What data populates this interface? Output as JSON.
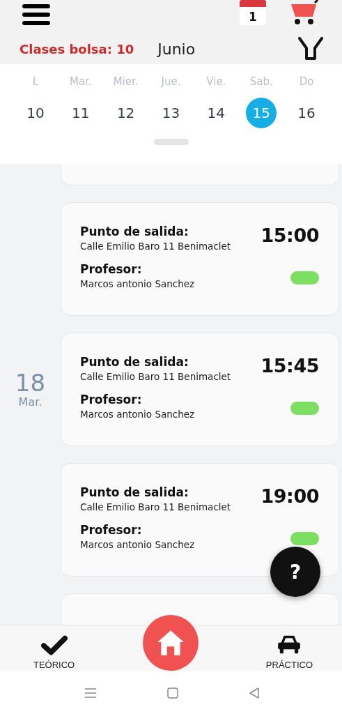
{
  "header": {
    "calendar_badge": "1",
    "credits": "Clases bolsa: 10",
    "month": "Junio"
  },
  "week": [
    {
      "weekday": "L",
      "day": "10",
      "selected": false
    },
    {
      "weekday": "Mar.",
      "day": "11",
      "selected": false
    },
    {
      "weekday": "Mier.",
      "day": "12",
      "selected": false
    },
    {
      "weekday": "Jue.",
      "day": "13",
      "selected": false
    },
    {
      "weekday": "Vie.",
      "day": "14",
      "selected": false
    },
    {
      "weekday": "Sab.",
      "day": "15",
      "selected": true
    },
    {
      "weekday": "Do",
      "day": "16",
      "selected": false
    }
  ],
  "classes": [
    {
      "start_label": "Punto de salida:",
      "address": "Calle Emilio Baro 11 Benimaclet",
      "teacher_label": "Profesor:",
      "teacher": "Marcos antonio Sanchez",
      "time": "15:00",
      "color": "#7ddf62"
    },
    {
      "date_day": "18",
      "date_weekday": "Mar.",
      "start_label": "Punto de salida:",
      "address": "Calle Emilio Baro 11 Benimaclet",
      "teacher_label": "Profesor:",
      "teacher": "Marcos antonio Sanchez",
      "time": "15:45",
      "color": "#7ddf62"
    },
    {
      "start_label": "Punto de salida:",
      "address": "Calle Emilio Baro 11 Benimaclet",
      "teacher_label": "Profesor:",
      "teacher": "Marcos antonio Sanchez",
      "time": "19:00",
      "color": "#7ddf62"
    }
  ],
  "help_button": "?",
  "nav": [
    {
      "kind": "check",
      "label": "TEÓRICO"
    },
    {
      "kind": "home"
    },
    {
      "kind": "car",
      "label": "PRÁCTICO"
    }
  ]
}
